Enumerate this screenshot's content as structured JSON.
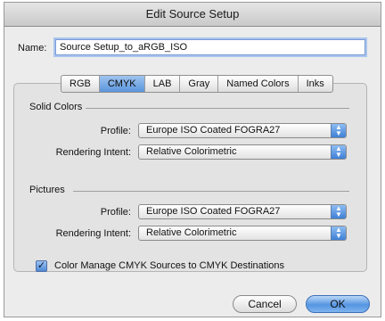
{
  "window": {
    "title": "Edit Source Setup"
  },
  "name_field": {
    "label": "Name:",
    "value": "Source Setup_to_aRGB_ISO"
  },
  "tabs": [
    {
      "label": "RGB",
      "selected": false
    },
    {
      "label": "CMYK",
      "selected": true
    },
    {
      "label": "LAB",
      "selected": false
    },
    {
      "label": "Gray",
      "selected": false
    },
    {
      "label": "Named Colors",
      "selected": false
    },
    {
      "label": "Inks",
      "selected": false
    }
  ],
  "solid_colors": {
    "heading": "Solid Colors",
    "profile_label": "Profile:",
    "profile_value": "Europe ISO Coated FOGRA27",
    "intent_label": "Rendering Intent:",
    "intent_value": "Relative Colorimetric"
  },
  "pictures": {
    "heading": "Pictures",
    "profile_label": "Profile:",
    "profile_value": "Europe ISO Coated FOGRA27",
    "intent_label": "Rendering Intent:",
    "intent_value": "Relative Colorimetric"
  },
  "color_manage": {
    "label": "Color Manage CMYK Sources to CMYK Destinations",
    "checked": true,
    "check_glyph": "✓"
  },
  "buttons": {
    "cancel": "Cancel",
    "ok": "OK"
  },
  "colors": {
    "accent": "#5a95dc",
    "window_bg": "#ececec"
  },
  "icons": {
    "popup_arrows": "up-down-arrows-icon",
    "checkmark": "checkmark-icon"
  }
}
